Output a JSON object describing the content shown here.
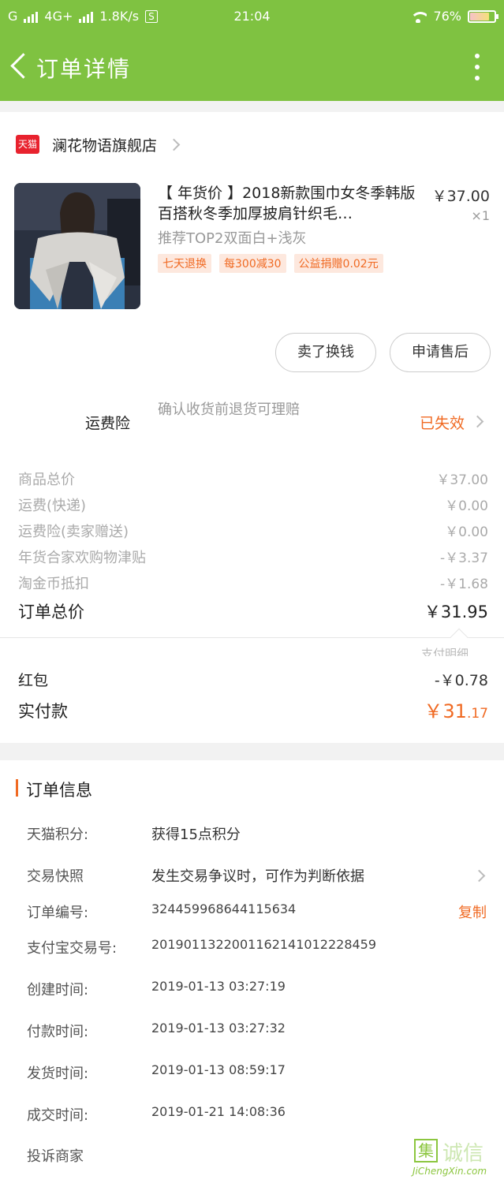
{
  "status_bar": {
    "carrier": "G",
    "network": "4G+",
    "speed": "1.8K/s",
    "s_badge": "S",
    "time": "21:04",
    "battery": "76%",
    "battery_level": 0.76
  },
  "header": {
    "title": "订单详情"
  },
  "shop": {
    "badge": "天猫",
    "name": "澜花物语旗舰店"
  },
  "product": {
    "title": "【 年货价 】2018新款围巾女冬季韩版百搭秋冬季加厚披肩针织毛…",
    "price": "￥37.00",
    "quantity": "×1",
    "sku": "推荐TOP2双面白+浅灰",
    "tags": [
      "七天退换",
      "每300减30",
      "公益捐赠0.02元"
    ]
  },
  "actions": {
    "sell_label": "卖了换钱",
    "after_sale_label": "申请售后"
  },
  "insurance": {
    "label": "运费险",
    "description": "确认收货前退货可理赔",
    "status": "已失效"
  },
  "fees": [
    {
      "label": "商品总价",
      "value": "￥37.00"
    },
    {
      "label": "运费(快递)",
      "value": "￥0.00"
    },
    {
      "label": "运费险(卖家赠送)",
      "value": "￥0.00"
    },
    {
      "label": "年货合家欢购物津贴",
      "value": "-￥3.37"
    },
    {
      "label": "淘金币抵扣",
      "value": "-￥1.68"
    }
  ],
  "order_total": {
    "label": "订单总价",
    "value": "￥31.95"
  },
  "partial_hidden_text": "支付明细",
  "red_packet": {
    "label": "红包",
    "value": "-￥0.78"
  },
  "paid": {
    "label": "实付款",
    "currency": "￥",
    "integer": "31",
    "decimal": ".17"
  },
  "order_info": {
    "title": "订单信息",
    "rows": [
      {
        "key": "天猫积分:",
        "value": "获得15点积分"
      },
      {
        "key": "交易快照",
        "value": "发生交易争议时，可作为判断依据"
      },
      {
        "key": "订单编号:",
        "value": "324459968644115634",
        "action": "复制"
      },
      {
        "key": "支付宝交易号:",
        "value": "2019011322001162141012228459"
      },
      {
        "key": "创建时间:",
        "value": "2019-01-13 03:27:19"
      },
      {
        "key": "付款时间:",
        "value": "2019-01-13 03:27:32"
      },
      {
        "key": "发货时间:",
        "value": "2019-01-13 08:59:17"
      },
      {
        "key": "成交时间:",
        "value": "2019-01-21 14:08:36"
      },
      {
        "key": "投诉商家",
        "value": ""
      }
    ]
  },
  "watermark": {
    "box_char": "集",
    "text": "诚信",
    "sub": "JiChengXin.com"
  }
}
